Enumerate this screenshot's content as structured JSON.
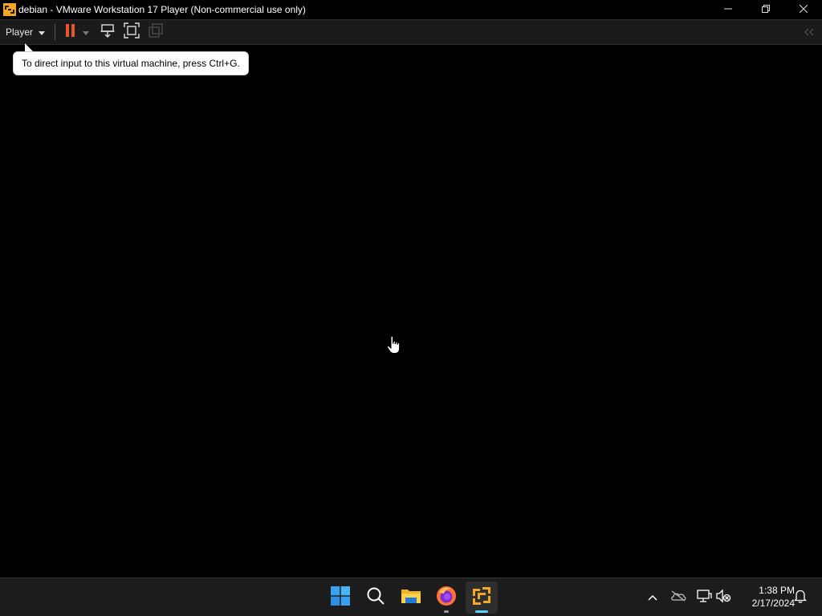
{
  "window": {
    "title": "debian - VMware Workstation 17 Player (Non-commercial use only)",
    "controls": [
      "minimize",
      "restore",
      "close"
    ]
  },
  "toolbar": {
    "player_menu_label": "Player",
    "buttons": [
      {
        "name": "pause-icon",
        "color": "#e8552a"
      },
      {
        "name": "send-ctrl-alt-del-icon"
      },
      {
        "name": "full-screen-icon"
      },
      {
        "name": "unity-icon",
        "disabled": true
      }
    ]
  },
  "tooltip": {
    "text": "To direct input to this virtual machine, press Ctrl+G."
  },
  "taskbar": {
    "apps": [
      {
        "name": "windows-start-icon"
      },
      {
        "name": "search-icon"
      },
      {
        "name": "file-explorer-icon"
      },
      {
        "name": "firefox-icon"
      },
      {
        "name": "vmware-player-icon",
        "active": true
      }
    ],
    "tray": [
      "chevron-up-icon",
      "onedrive-icon",
      "network-icon",
      "volume-muted-icon",
      "notification-bell-icon"
    ],
    "clock": {
      "time": "1:38 PM",
      "date": "2/17/2024"
    }
  },
  "colors": {
    "accent": "#60cdff",
    "vmware_orange": "#f5a623",
    "pause_orange": "#e8552a"
  }
}
